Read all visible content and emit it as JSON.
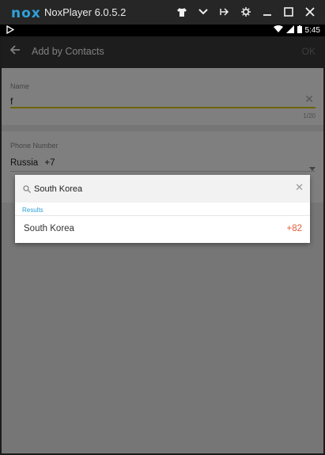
{
  "emulator": {
    "logo": "nox",
    "title": "NoxPlayer 6.0.5.2",
    "icons": [
      "shirt-icon",
      "chevron-down-icon",
      "pin-icon",
      "gear-icon",
      "minimize-icon",
      "maximize-icon",
      "close-icon"
    ]
  },
  "status_bar": {
    "time": "5:45",
    "icons": [
      "play-store-icon",
      "wifi-icon",
      "signal-icon",
      "battery-icon"
    ]
  },
  "app_bar": {
    "title": "Add by Contacts",
    "ok_label": "OK"
  },
  "form": {
    "name_label": "Name",
    "name_value": "f",
    "name_counter": "1/20",
    "phone_label": "Phone Number",
    "country": "Russia",
    "country_code": "+7"
  },
  "dialog": {
    "search_value": "South Korea",
    "results_label": "Results",
    "results": [
      {
        "country": "South Korea",
        "code": "+82"
      }
    ]
  },
  "colors": {
    "accent_yellow": "#dcc800",
    "results_blue": "#2f9fd8",
    "code_red": "#e05a3a"
  }
}
